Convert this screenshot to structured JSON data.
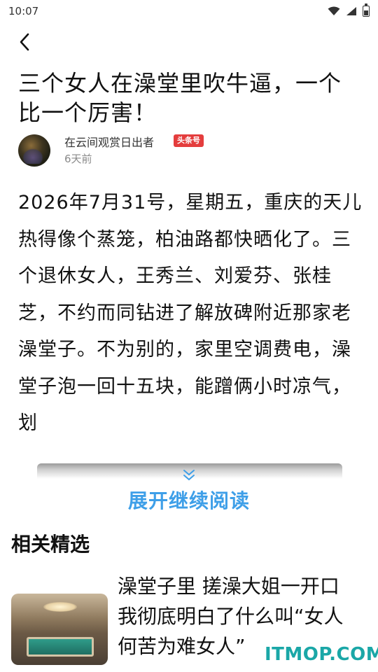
{
  "status_bar": {
    "time": "10:07"
  },
  "nav": {
    "back_icon": "chevron-left-icon"
  },
  "article": {
    "title": "三个女人在澡堂里吹牛逼，一个比一个厉害！",
    "author_name": "在云间观赏日出者",
    "author_badge": "头条号",
    "post_time": "6天前",
    "body_text": "2026年7月31号，星期五，重庆的天儿热得像个蒸笼，柏油路都快晒化了。三个退休女人，王秀兰、刘爱芬、张桂芝，不约而同钻进了解放碑附近那家老澡堂子。不为别的，家里空调费电，澡堂子泡一回十五块，能蹭俩小时凉气，划"
  },
  "expand": {
    "label": "展开继续阅读"
  },
  "related": {
    "heading": "相关精选",
    "items": [
      {
        "title": "澡堂子里 搓澡大姐一开口 我彻底明白了什么叫“女人何苦为难女人”"
      }
    ]
  },
  "watermark": "ITMOP.COM",
  "colors": {
    "accent_blue": "#3e9fe8",
    "badge_red": "#e43d3d",
    "watermark_teal": "#1aa7a7"
  }
}
